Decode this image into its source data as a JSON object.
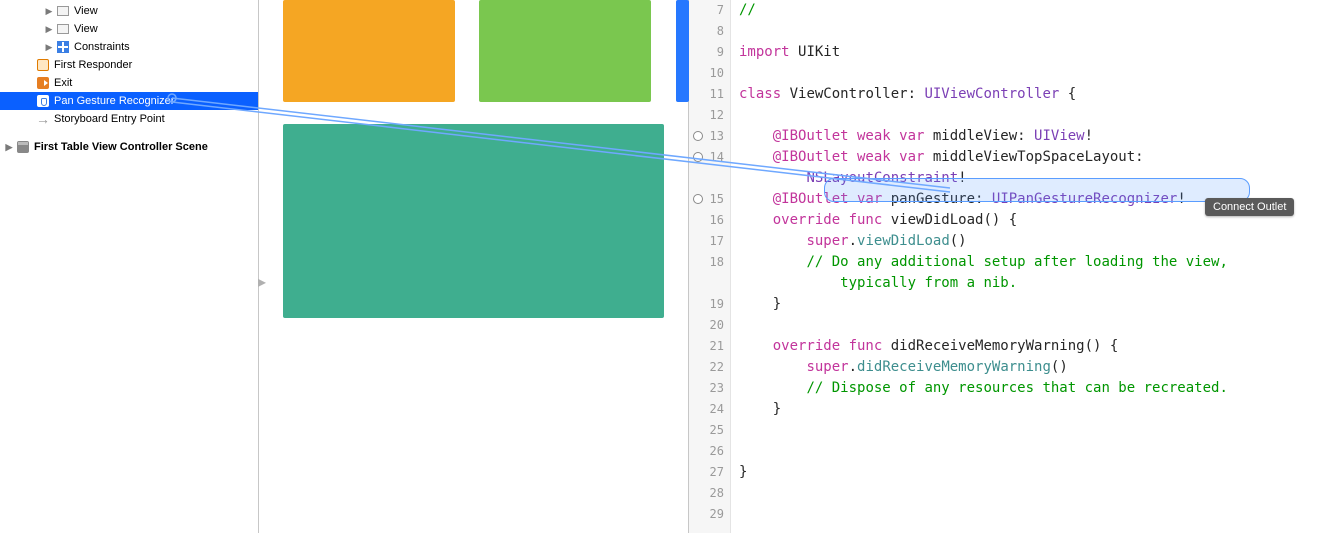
{
  "navigator": {
    "items": [
      {
        "label": "View",
        "indent": 2,
        "icon": "view",
        "disclose": true
      },
      {
        "label": "View",
        "indent": 2,
        "icon": "view",
        "disclose": true
      },
      {
        "label": "Constraints",
        "indent": 2,
        "icon": "constraints",
        "disclose": true
      },
      {
        "label": "First Responder",
        "indent": 1,
        "icon": "responder"
      },
      {
        "label": "Exit",
        "indent": 1,
        "icon": "exit"
      },
      {
        "label": "Pan Gesture Recognizer",
        "indent": 1,
        "icon": "pan",
        "selected": true
      },
      {
        "label": "Storyboard Entry Point",
        "indent": 1,
        "icon": "arrow"
      }
    ],
    "scene_label": "First Table View Controller Scene"
  },
  "tooltip": "Connect Outlet",
  "code": {
    "lines": [
      {
        "n": 7,
        "raw": "//",
        "type": "cmt"
      },
      {
        "n": 8,
        "raw": ""
      },
      {
        "n": 9,
        "tokens": [
          [
            "kw-pink",
            "import"
          ],
          [
            "sp",
            " "
          ],
          [
            "id-black",
            "UIKit"
          ]
        ]
      },
      {
        "n": 10,
        "raw": ""
      },
      {
        "n": 11,
        "tokens": [
          [
            "kw-pink",
            "class"
          ],
          [
            "sp",
            " "
          ],
          [
            "id-black",
            "ViewController: "
          ],
          [
            "kw-purple",
            "UIViewController"
          ],
          [
            "punct",
            " {"
          ]
        ]
      },
      {
        "n": 12,
        "raw": ""
      },
      {
        "n": 13,
        "conn": "open",
        "tokens": [
          [
            "sp",
            "    "
          ],
          [
            "kw-pink",
            "@IBOutlet weak var"
          ],
          [
            "sp",
            " "
          ],
          [
            "id-black",
            "middleView: "
          ],
          [
            "kw-purple",
            "UIView"
          ],
          [
            "punct",
            "!"
          ]
        ]
      },
      {
        "n": 14,
        "conn": "open",
        "tokens": [
          [
            "sp",
            "    "
          ],
          [
            "kw-pink",
            "@IBOutlet weak var"
          ],
          [
            "sp",
            " "
          ],
          [
            "id-black",
            "middleViewTopSpaceLayout:"
          ]
        ]
      },
      {
        "n": "14b",
        "tokens": [
          [
            "sp",
            "        "
          ],
          [
            "kw-purple",
            "NSLayoutConstraint"
          ],
          [
            "punct",
            "!"
          ]
        ]
      },
      {
        "n": 15,
        "conn": "open",
        "tokens": [
          [
            "sp",
            "    "
          ],
          [
            "kw-pink",
            "@IBOutlet var"
          ],
          [
            "sp",
            " "
          ],
          [
            "id-black",
            "panGesture: "
          ],
          [
            "kw-purple",
            "UIPanGestureRecognizer"
          ],
          [
            "punct",
            "!"
          ]
        ]
      },
      {
        "n": 16,
        "tokens": [
          [
            "sp",
            "    "
          ],
          [
            "kw-pink",
            "override func"
          ],
          [
            "sp",
            " "
          ],
          [
            "id-black",
            "viewDidLoad"
          ],
          [
            "punct",
            "() {"
          ]
        ]
      },
      {
        "n": 17,
        "tokens": [
          [
            "sp",
            "        "
          ],
          [
            "kw-pink",
            "super"
          ],
          [
            "punct",
            "."
          ],
          [
            "kw-teal",
            "viewDidLoad"
          ],
          [
            "punct",
            "()"
          ]
        ]
      },
      {
        "n": 18,
        "tokens": [
          [
            "sp",
            "        "
          ],
          [
            "cmt",
            "// Do any additional setup after loading the view,"
          ]
        ]
      },
      {
        "n": "18b",
        "tokens": [
          [
            "sp",
            "            "
          ],
          [
            "cmt",
            "typically from a nib."
          ]
        ]
      },
      {
        "n": 19,
        "tokens": [
          [
            "sp",
            "    "
          ],
          [
            "punct",
            "}"
          ]
        ]
      },
      {
        "n": 20,
        "raw": ""
      },
      {
        "n": 21,
        "tokens": [
          [
            "sp",
            "    "
          ],
          [
            "kw-pink",
            "override func"
          ],
          [
            "sp",
            " "
          ],
          [
            "id-black",
            "didReceiveMemoryWarning"
          ],
          [
            "punct",
            "() {"
          ]
        ]
      },
      {
        "n": 22,
        "tokens": [
          [
            "sp",
            "        "
          ],
          [
            "kw-pink",
            "super"
          ],
          [
            "punct",
            "."
          ],
          [
            "kw-teal",
            "didReceiveMemoryWarning"
          ],
          [
            "punct",
            "()"
          ]
        ]
      },
      {
        "n": 23,
        "tokens": [
          [
            "sp",
            "        "
          ],
          [
            "cmt",
            "// Dispose of any resources that can be recreated."
          ]
        ]
      },
      {
        "n": 24,
        "tokens": [
          [
            "sp",
            "    "
          ],
          [
            "punct",
            "}"
          ]
        ]
      },
      {
        "n": 25,
        "raw": ""
      },
      {
        "n": 26,
        "raw": ""
      },
      {
        "n": 27,
        "tokens": [
          [
            "punct",
            "}"
          ]
        ]
      },
      {
        "n": 28,
        "raw": ""
      },
      {
        "n": 29,
        "raw": ""
      }
    ]
  }
}
